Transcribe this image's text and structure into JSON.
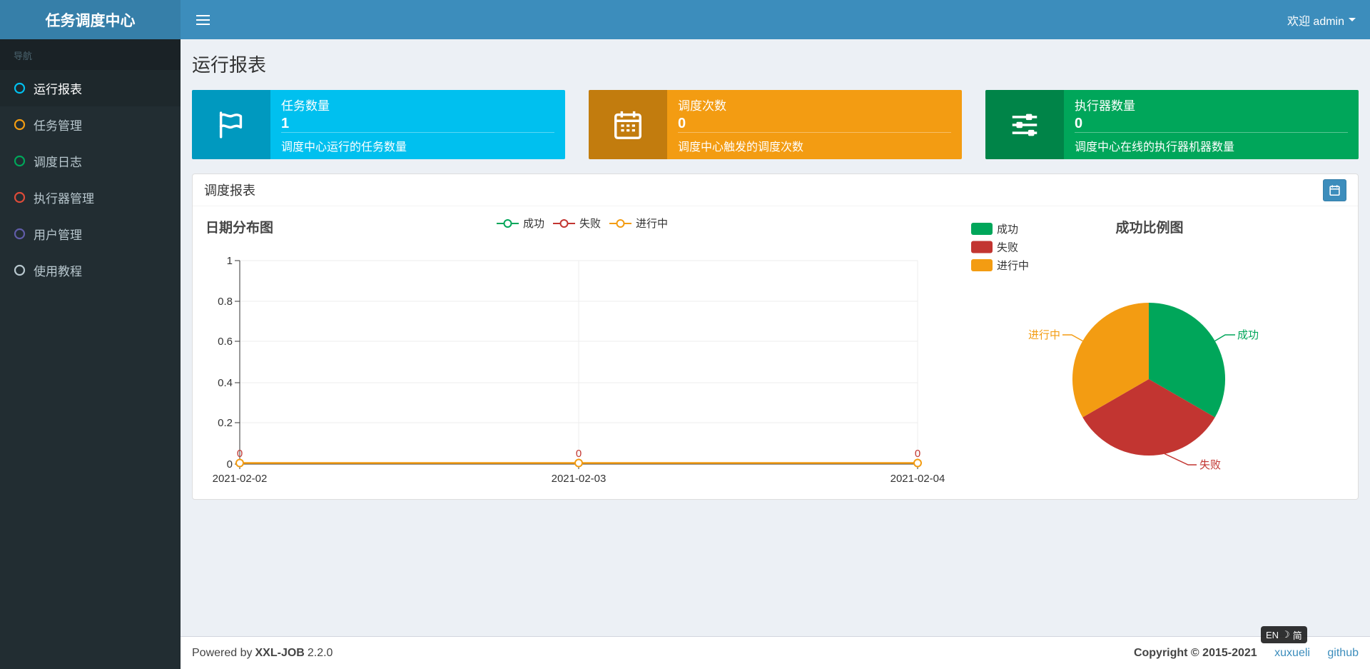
{
  "header": {
    "app_title": "任务调度中心",
    "welcome": "欢迎 admin"
  },
  "sidebar": {
    "nav_label": "导航",
    "items": [
      {
        "label": "运行报表",
        "color": "#00c0ef"
      },
      {
        "label": "任务管理",
        "color": "#f39c12"
      },
      {
        "label": "调度日志",
        "color": "#00a65a"
      },
      {
        "label": "执行器管理",
        "color": "#dd4b39"
      },
      {
        "label": "用户管理",
        "color": "#605ca8"
      },
      {
        "label": "使用教程",
        "color": "#b8c7ce"
      }
    ]
  },
  "page": {
    "title": "运行报表"
  },
  "info_boxes": [
    {
      "label": "任务数量",
      "value": "1",
      "desc": "调度中心运行的任务数量",
      "color": "#00c0ef",
      "icon": "flag-icon"
    },
    {
      "label": "调度次数",
      "value": "0",
      "desc": "调度中心触发的调度次数",
      "color": "#f39c12",
      "icon": "calendar-icon"
    },
    {
      "label": "执行器数量",
      "value": "0",
      "desc": "调度中心在线的执行器机器数量",
      "color": "#00a65a",
      "icon": "sliders-icon"
    }
  ],
  "panel": {
    "title": "调度报表",
    "date_button_icon": "calendar-icon"
  },
  "chart_data": [
    {
      "type": "line",
      "title": "日期分布图",
      "x": [
        "2021-02-02",
        "2021-02-03",
        "2021-02-04"
      ],
      "series": [
        {
          "name": "成功",
          "color": "#00A65A",
          "values": [
            0,
            0,
            0
          ]
        },
        {
          "name": "失败",
          "color": "#C23531",
          "values": [
            0,
            0,
            0
          ]
        },
        {
          "name": "进行中",
          "color": "#F39C12",
          "values": [
            0,
            0,
            0
          ]
        }
      ],
      "ylim": [
        0,
        1
      ],
      "yticks": [
        "0",
        "0.2",
        "0.4",
        "0.6",
        "0.8",
        "1"
      ],
      "point_labels": [
        "0",
        "0",
        "0"
      ],
      "legend_position": "top-center",
      "grid": true
    },
    {
      "type": "pie",
      "title": "成功比例图",
      "slices": [
        {
          "name": "成功",
          "color": "#00A65A",
          "value": 33.3
        },
        {
          "name": "失败",
          "color": "#C23531",
          "value": 33.3
        },
        {
          "name": "进行中",
          "color": "#F39C12",
          "value": 33.4
        }
      ],
      "legend_position": "top-left"
    }
  ],
  "footer": {
    "powered_by": "Powered by",
    "brand": "XXL-JOB",
    "version": "2.2.0",
    "copyright": "Copyright © 2015-2021",
    "link_author": "xuxueli",
    "link_github": "github"
  },
  "ime": {
    "en": "EN",
    "moon": "☽",
    "cn": "简"
  }
}
